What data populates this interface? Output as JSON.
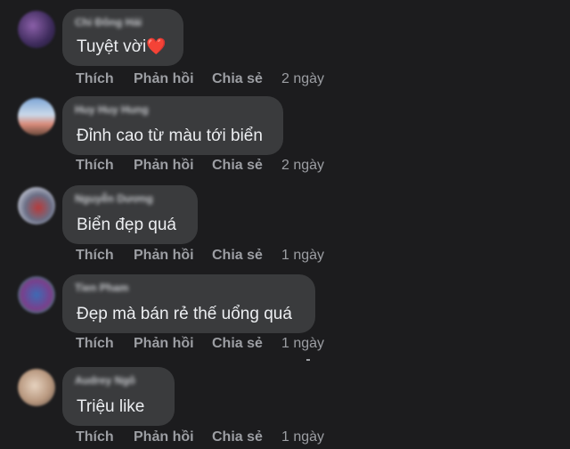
{
  "actions": {
    "like": "Thích",
    "reply": "Phản hồi",
    "share": "Chia sẻ"
  },
  "comments": [
    {
      "author": "Chi Đông Hải",
      "text": "Tuyệt vời",
      "emoji": "❤️",
      "time": "2 ngày"
    },
    {
      "author": "Huy Huy Hung",
      "text": "Đỉnh cao từ màu tới biển",
      "time": "2 ngày"
    },
    {
      "author": "Nguyễn Dương",
      "text": "Biển đẹp quá",
      "time": "1 ngày"
    },
    {
      "author": "Tien Pham",
      "text": "Đẹp mà bán rẻ thế uổng quá",
      "time": "1 ngày"
    },
    {
      "author": "Audrey Ngô",
      "text": "Triệu like",
      "time": "1 ngày"
    }
  ],
  "colors": {
    "background": "#1c1c1e",
    "bubble": "#3a3b3d",
    "action_text": "#9c9ea3",
    "heart": "#e0245e"
  }
}
